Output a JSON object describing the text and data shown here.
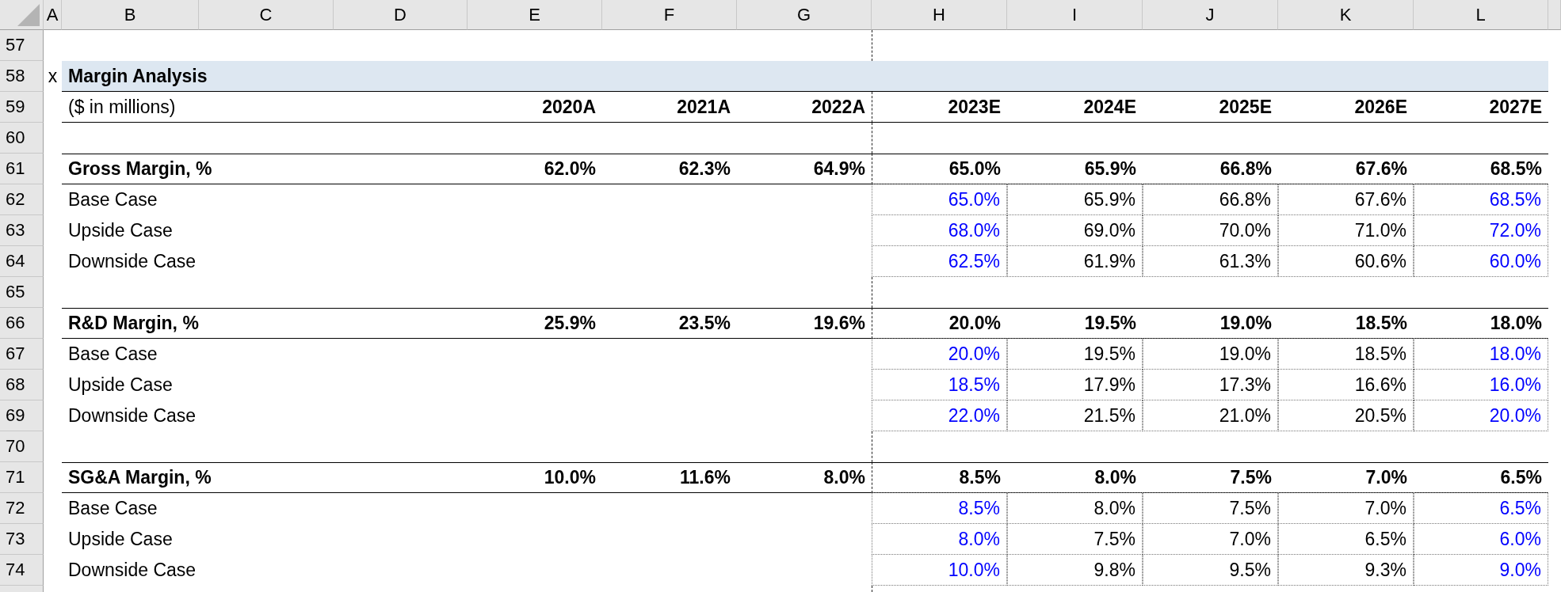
{
  "columns": [
    "A",
    "B",
    "C",
    "D",
    "E",
    "F",
    "G",
    "H",
    "I",
    "J",
    "K",
    "L"
  ],
  "rows": [
    {
      "number": "57",
      "kind": "blank"
    },
    {
      "number": "58",
      "kind": "title",
      "marker": "x",
      "label": "Margin Analysis"
    },
    {
      "number": "59",
      "kind": "units",
      "label": "($ in millions)",
      "values": [
        {
          "value": "2020A"
        },
        {
          "value": "2021A"
        },
        {
          "value": "2022A"
        },
        {
          "value": "2023E"
        },
        {
          "value": "2024E"
        },
        {
          "value": "2025E"
        },
        {
          "value": "2026E"
        },
        {
          "value": "2027E"
        }
      ]
    },
    {
      "number": "60",
      "kind": "blank"
    },
    {
      "number": "61",
      "kind": "section",
      "label": "Gross Margin, %",
      "values": [
        {
          "value": "62.0%"
        },
        {
          "value": "62.3%"
        },
        {
          "value": "64.9%"
        },
        {
          "value": "65.0%"
        },
        {
          "value": "65.9%"
        },
        {
          "value": "66.8%"
        },
        {
          "value": "67.6%"
        },
        {
          "value": "68.5%"
        }
      ]
    },
    {
      "number": "62",
      "kind": "case",
      "label": "Base Case",
      "values": [
        {
          "value": "65.0%",
          "input": true
        },
        {
          "value": "65.9%",
          "input": false
        },
        {
          "value": "66.8%",
          "input": false
        },
        {
          "value": "67.6%",
          "input": false
        },
        {
          "value": "68.5%",
          "input": true
        }
      ]
    },
    {
      "number": "63",
      "kind": "case",
      "label": "Upside Case",
      "values": [
        {
          "value": "68.0%",
          "input": true
        },
        {
          "value": "69.0%",
          "input": false
        },
        {
          "value": "70.0%",
          "input": false
        },
        {
          "value": "71.0%",
          "input": false
        },
        {
          "value": "72.0%",
          "input": true
        }
      ]
    },
    {
      "number": "64",
      "kind": "case",
      "label": "Downside Case",
      "values": [
        {
          "value": "62.5%",
          "input": true
        },
        {
          "value": "61.9%",
          "input": false
        },
        {
          "value": "61.3%",
          "input": false
        },
        {
          "value": "60.6%",
          "input": false
        },
        {
          "value": "60.0%",
          "input": true
        }
      ]
    },
    {
      "number": "65",
      "kind": "blank"
    },
    {
      "number": "66",
      "kind": "section",
      "label": "R&D Margin, %",
      "values": [
        {
          "value": "25.9%"
        },
        {
          "value": "23.5%"
        },
        {
          "value": "19.6%"
        },
        {
          "value": "20.0%"
        },
        {
          "value": "19.5%"
        },
        {
          "value": "19.0%"
        },
        {
          "value": "18.5%"
        },
        {
          "value": "18.0%"
        }
      ]
    },
    {
      "number": "67",
      "kind": "case",
      "label": "Base Case",
      "values": [
        {
          "value": "20.0%",
          "input": true
        },
        {
          "value": "19.5%",
          "input": false
        },
        {
          "value": "19.0%",
          "input": false
        },
        {
          "value": "18.5%",
          "input": false
        },
        {
          "value": "18.0%",
          "input": true
        }
      ]
    },
    {
      "number": "68",
      "kind": "case",
      "label": "Upside Case",
      "values": [
        {
          "value": "18.5%",
          "input": true
        },
        {
          "value": "17.9%",
          "input": false
        },
        {
          "value": "17.3%",
          "input": false
        },
        {
          "value": "16.6%",
          "input": false
        },
        {
          "value": "16.0%",
          "input": true
        }
      ]
    },
    {
      "number": "69",
      "kind": "case",
      "label": "Downside Case",
      "values": [
        {
          "value": "22.0%",
          "input": true
        },
        {
          "value": "21.5%",
          "input": false
        },
        {
          "value": "21.0%",
          "input": false
        },
        {
          "value": "20.5%",
          "input": false
        },
        {
          "value": "20.0%",
          "input": true
        }
      ]
    },
    {
      "number": "70",
      "kind": "blank"
    },
    {
      "number": "71",
      "kind": "section",
      "label": "SG&A Margin, %",
      "values": [
        {
          "value": "10.0%"
        },
        {
          "value": "11.6%"
        },
        {
          "value": "8.0%"
        },
        {
          "value": "8.5%"
        },
        {
          "value": "8.0%"
        },
        {
          "value": "7.5%"
        },
        {
          "value": "7.0%"
        },
        {
          "value": "6.5%"
        }
      ]
    },
    {
      "number": "72",
      "kind": "case",
      "label": "Base Case",
      "values": [
        {
          "value": "8.5%",
          "input": true
        },
        {
          "value": "8.0%",
          "input": false
        },
        {
          "value": "7.5%",
          "input": false
        },
        {
          "value": "7.0%",
          "input": false
        },
        {
          "value": "6.5%",
          "input": true
        }
      ]
    },
    {
      "number": "73",
      "kind": "case",
      "label": "Upside Case",
      "values": [
        {
          "value": "8.0%",
          "input": true
        },
        {
          "value": "7.5%",
          "input": false
        },
        {
          "value": "7.0%",
          "input": false
        },
        {
          "value": "6.5%",
          "input": false
        },
        {
          "value": "6.0%",
          "input": true
        }
      ]
    },
    {
      "number": "74",
      "kind": "case",
      "label": "Downside Case",
      "values": [
        {
          "value": "10.0%",
          "input": true
        },
        {
          "value": "9.8%",
          "input": false
        },
        {
          "value": "9.5%",
          "input": false
        },
        {
          "value": "9.3%",
          "input": false
        },
        {
          "value": "9.0%",
          "input": true
        }
      ]
    }
  ]
}
